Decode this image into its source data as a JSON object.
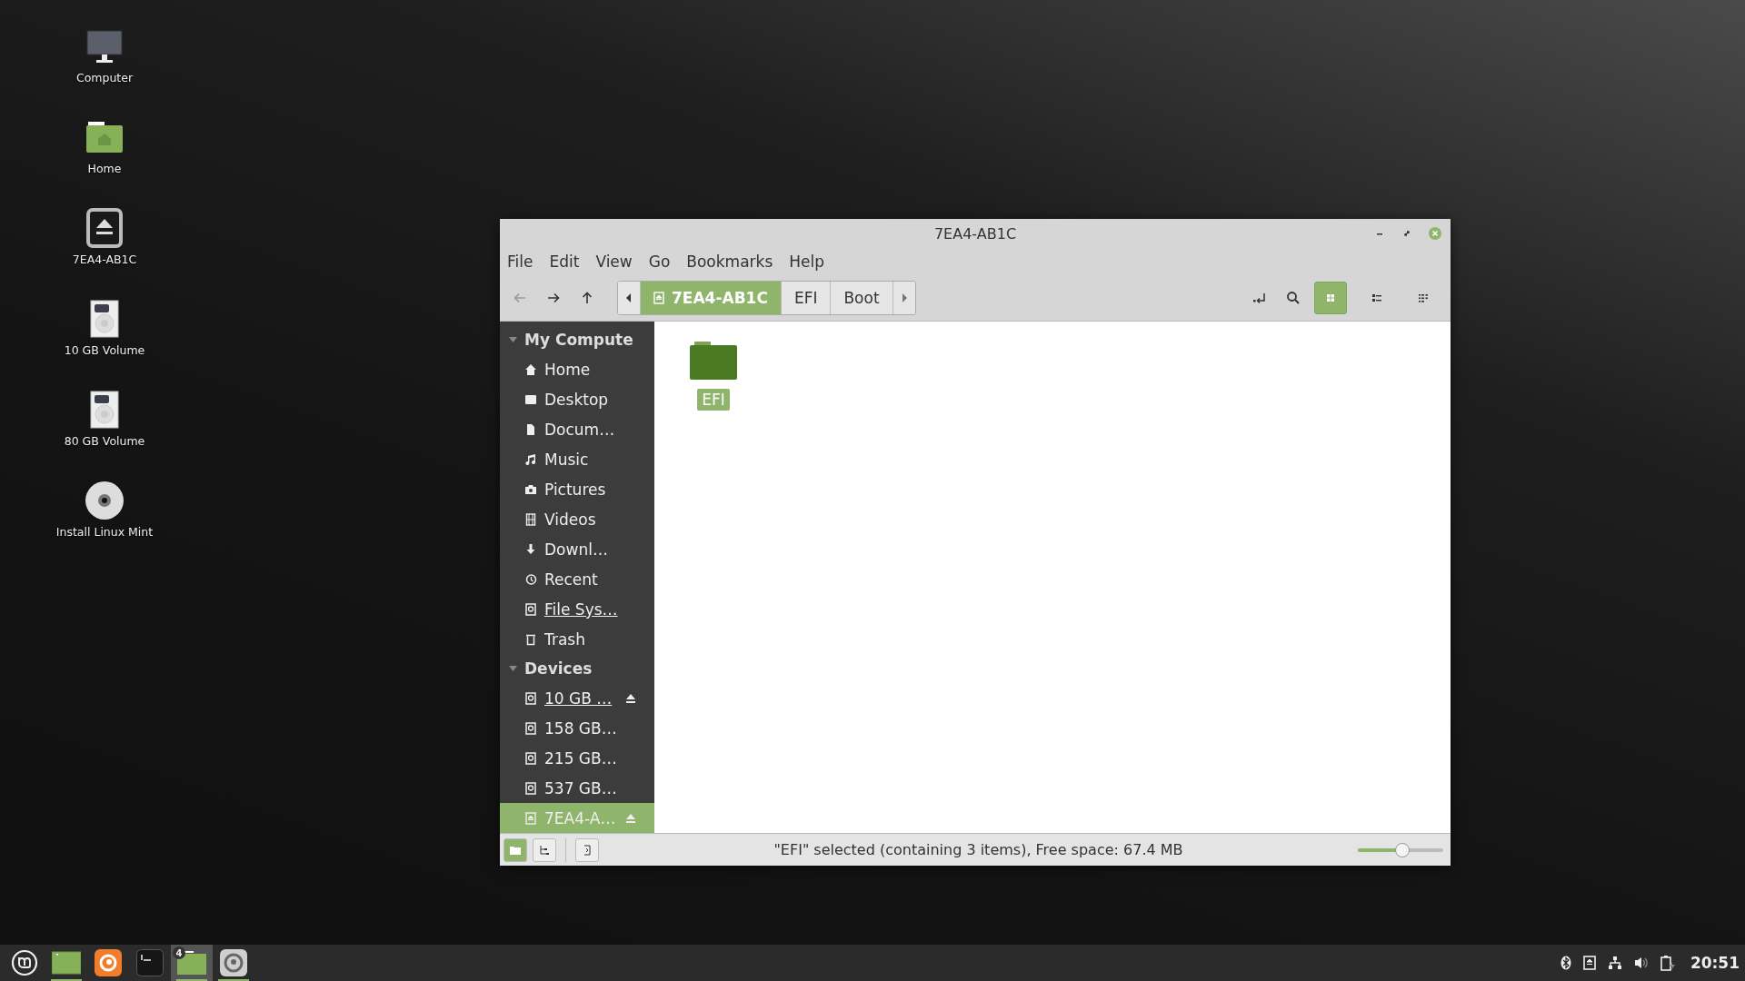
{
  "desktop_icons": [
    {
      "label": "Computer",
      "kind": "computer"
    },
    {
      "label": "Home",
      "kind": "home"
    },
    {
      "label": "7EA4-AB1C",
      "kind": "eject"
    },
    {
      "label": "10 GB Volume",
      "kind": "drive"
    },
    {
      "label": "80 GB Volume",
      "kind": "drive"
    },
    {
      "label": "Install Linux Mint",
      "kind": "disc"
    }
  ],
  "window": {
    "title": "7EA4-AB1C",
    "menu": [
      "File",
      "Edit",
      "View",
      "Go",
      "Bookmarks",
      "Help"
    ],
    "path": [
      {
        "label": "7EA4-AB1C",
        "selected": true,
        "icon": true
      },
      {
        "label": "EFI",
        "selected": false,
        "icon": false
      },
      {
        "label": "Boot",
        "selected": false,
        "icon": false
      }
    ],
    "view_buttons": [
      {
        "kind": "icons",
        "selected": true
      },
      {
        "kind": "list",
        "selected": false
      },
      {
        "kind": "compact",
        "selected": false
      }
    ],
    "sidebar": [
      {
        "title": "My Compute",
        "items": [
          {
            "label": "Home",
            "kind": "home",
            "underlined": false,
            "eject": false,
            "selected": false
          },
          {
            "label": "Desktop",
            "kind": "desktop",
            "underlined": false,
            "eject": false,
            "selected": false
          },
          {
            "label": "Docum…",
            "kind": "document",
            "underlined": false,
            "eject": false,
            "selected": false
          },
          {
            "label": "Music",
            "kind": "music",
            "underlined": false,
            "eject": false,
            "selected": false
          },
          {
            "label": "Pictures",
            "kind": "camera",
            "underlined": false,
            "eject": false,
            "selected": false
          },
          {
            "label": "Videos",
            "kind": "film",
            "underlined": false,
            "eject": false,
            "selected": false
          },
          {
            "label": "Downl…",
            "kind": "download",
            "underlined": false,
            "eject": false,
            "selected": false
          },
          {
            "label": "Recent",
            "kind": "recent",
            "underlined": false,
            "eject": false,
            "selected": false
          },
          {
            "label": "File Sys…",
            "kind": "drive",
            "underlined": true,
            "eject": false,
            "selected": false
          },
          {
            "label": "Trash",
            "kind": "trash",
            "underlined": false,
            "eject": false,
            "selected": false
          }
        ]
      },
      {
        "title": "Devices",
        "items": [
          {
            "label": "10 GB …",
            "kind": "drive",
            "underlined": true,
            "eject": true,
            "selected": false
          },
          {
            "label": "158 GB…",
            "kind": "drive",
            "underlined": false,
            "eject": false,
            "selected": false
          },
          {
            "label": "215 GB…",
            "kind": "drive",
            "underlined": false,
            "eject": false,
            "selected": false
          },
          {
            "label": "537 GB…",
            "kind": "drive",
            "underlined": false,
            "eject": false,
            "selected": false
          },
          {
            "label": "7EA4-A…",
            "kind": "removable",
            "underlined": false,
            "eject": true,
            "selected": true
          }
        ]
      }
    ],
    "files": [
      {
        "name": "EFI",
        "selected": true
      }
    ],
    "status_buttons": [
      {
        "kind": "places",
        "selected": true
      },
      {
        "kind": "tree",
        "selected": false
      },
      {
        "kind": "hide",
        "selected": false
      }
    ],
    "status": "\"EFI\" selected (containing 3 items), Free space: 67.4 MB",
    "zoom": {
      "level": 0.53
    }
  },
  "taskbar": {
    "items": [
      {
        "kind": "menu",
        "running": false,
        "active": false
      },
      {
        "kind": "desktop",
        "running": true,
        "active": false
      },
      {
        "kind": "firefox",
        "running": false,
        "active": false
      },
      {
        "kind": "terminal",
        "running": false,
        "active": false
      },
      {
        "kind": "files",
        "running": true,
        "active": true,
        "badge": "4"
      },
      {
        "kind": "disk",
        "running": true,
        "active": false
      }
    ],
    "clock": "20:51"
  }
}
